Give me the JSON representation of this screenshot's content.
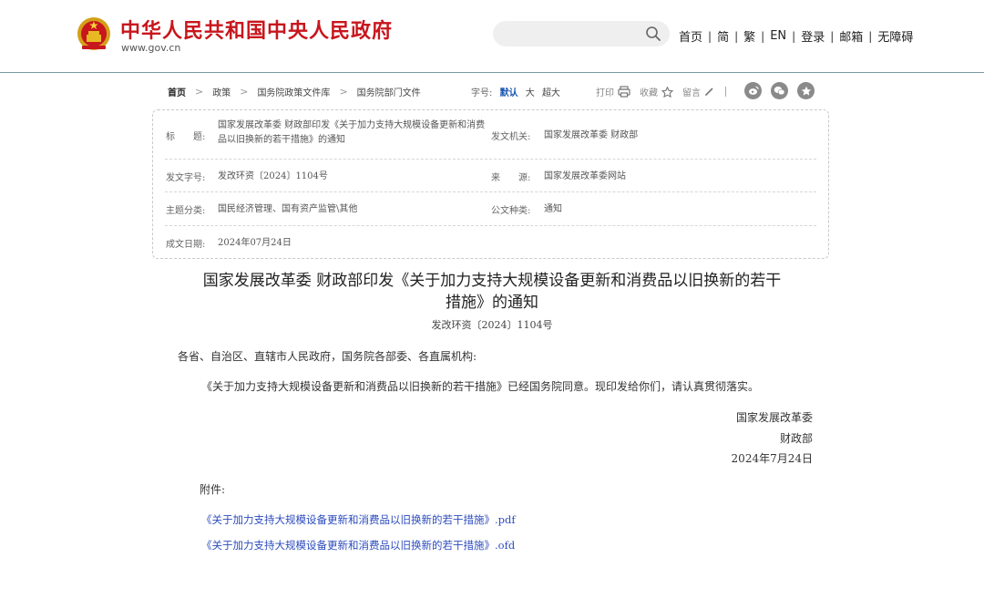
{
  "header": {
    "site_title": "中华人民共和国中央人民政府",
    "site_url": "www.gov.cn",
    "search_placeholder": "",
    "nav": [
      "首页",
      "简",
      "繁",
      "EN",
      "登录",
      "邮箱",
      "无障碍"
    ],
    "nav_separator": "|",
    "brand_color": "#c8161d"
  },
  "breadcrumb": {
    "items": [
      "首页",
      "政策",
      "国务院政策文件库",
      "国务院部门文件"
    ],
    "separator": ">"
  },
  "font_size": {
    "label": "字号:",
    "options": [
      "默认",
      "大",
      "超大"
    ],
    "active": "默认"
  },
  "tools": {
    "print": "打印",
    "favorite": "收藏",
    "comment": "留言",
    "share_icons": [
      "weibo-icon",
      "wechat-icon",
      "favorites-star-icon"
    ]
  },
  "info": {
    "title_label": "标　　题:",
    "title_value": "国家发展改革委 财政部印发《关于加力支持大规模设备更新和消费品以旧换新的若干措施》的通知",
    "issuer_label": "发文机关:",
    "issuer_value": "国家发展改革委 财政部",
    "docno_label": "发文字号:",
    "docno_value": "发改环资〔2024〕1104号",
    "source_label": "来　　源:",
    "source_value": "国家发展改革委网站",
    "topic_label": "主题分类:",
    "topic_value": "国民经济管理、国有资产监管\\其他",
    "type_label": "公文种类:",
    "type_value": "通知",
    "date_label": "成文日期:",
    "date_value": "2024年07月24日"
  },
  "article": {
    "title_line1": "国家发展改革委 财政部印发《关于加力支持大规模设备更新和消费品以旧换新的若干",
    "title_line2": "措施》的通知",
    "doc_number": "发改环资〔2024〕1104号",
    "salutation": "各省、自治区、直辖市人民政府，国务院各部委、各直属机构:",
    "body": "《关于加力支持大规模设备更新和消费品以旧换新的若干措施》已经国务院同意。现印发给你们，请认真贯彻落实。",
    "signer1": "国家发展改革委",
    "signer2": "财政部",
    "sign_date": "2024年7月24日",
    "attachment_label": "附件:",
    "attachment_pdf": "《关于加力支持大规模设备更新和消费品以旧换新的若干措施》.pdf",
    "attachment_ofd": "《关于加力支持大规模设备更新和消费品以旧换新的若干措施》.ofd"
  }
}
